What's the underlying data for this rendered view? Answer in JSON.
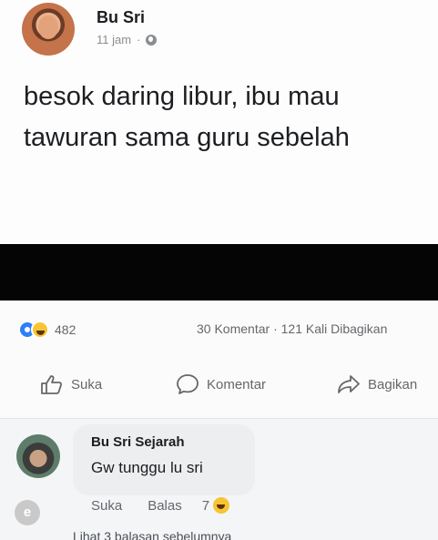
{
  "post": {
    "author": "Bu Sri",
    "time": "11 jam",
    "separator": "·",
    "text": "besok daring libur, ibu mau tawuran sama guru sebelah"
  },
  "stats": {
    "reaction_count": "482",
    "comments": "30 Komentar",
    "dot": "·",
    "shares": "121 Kali Dibagikan"
  },
  "actions": {
    "like": "Suka",
    "comment": "Komentar",
    "share": "Bagikan"
  },
  "comment": {
    "author": "Bu Sri Sejarah",
    "text": "Gw tunggu lu sri",
    "like": "Suka",
    "reply": "Balas",
    "reaction_count": "7",
    "view_more": "Lihat 3 balasan sebelumnya",
    "watermark": "e"
  }
}
